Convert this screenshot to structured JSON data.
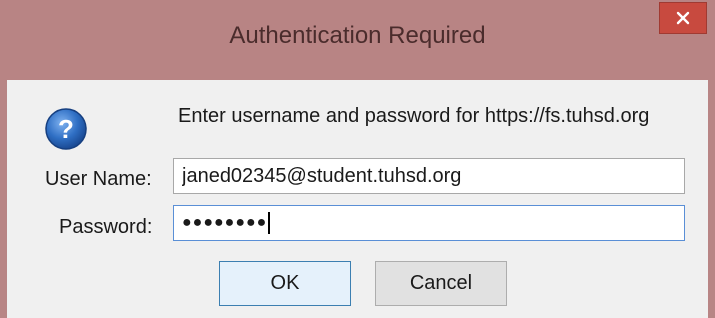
{
  "window": {
    "title": "Authentication Required",
    "close_glyph": "✕"
  },
  "dialog": {
    "icon": "question-icon",
    "message": "Enter username and password for https://fs.tuhsd.org",
    "username_label": "User Name:",
    "username_value": "janed02345@student.tuhsd.org",
    "password_label": "Password:",
    "password_mask": "●●●●●●●●",
    "ok_label": "OK",
    "cancel_label": "Cancel"
  },
  "colors": {
    "titlebar": "#b88484",
    "close_button": "#c84a3f",
    "icon_blue": "#2f6fc4"
  }
}
